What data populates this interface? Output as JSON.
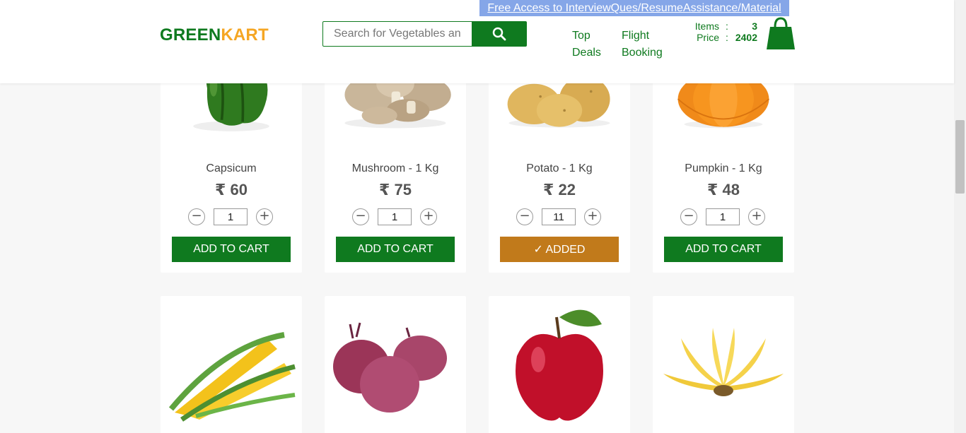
{
  "promo": {
    "text": "Free Access to InterviewQues/ResumeAssistance/Material"
  },
  "brand": {
    "part1": "GREEN",
    "part2": "KART"
  },
  "search": {
    "placeholder": "Search for Vegetables and Fruits",
    "value": ""
  },
  "nav": {
    "top_deals": "Top Deals",
    "flight_booking": "Flight Booking"
  },
  "cart": {
    "items_label": "Items",
    "items_sep": ":",
    "items_value": "3",
    "price_label": "Price",
    "price_sep": ":",
    "price_value": "2402"
  },
  "colors": {
    "brand_green": "#0f7a1f",
    "brand_orange": "#f5a623",
    "added": "#c17a1b",
    "promo": "#85a6e8"
  },
  "products": [
    {
      "name": "Capsicum",
      "price": "₹ 60",
      "qty": "1",
      "button": "ADD TO CART",
      "added": false,
      "image": "capsicum"
    },
    {
      "name": "Mushroom - 1 Kg",
      "price": "₹ 75",
      "qty": "1",
      "button": "ADD TO CART",
      "added": false,
      "image": "mushroom"
    },
    {
      "name": "Potato - 1 Kg",
      "price": "₹ 22",
      "qty": "11",
      "button": "✓ ADDED",
      "added": true,
      "image": "potato"
    },
    {
      "name": "Pumpkin - 1 Kg",
      "price": "₹ 48",
      "qty": "1",
      "button": "ADD TO CART",
      "added": false,
      "image": "pumpkin"
    },
    {
      "image": "corn"
    },
    {
      "image": "onion"
    },
    {
      "image": "apple"
    },
    {
      "image": "banana"
    }
  ]
}
